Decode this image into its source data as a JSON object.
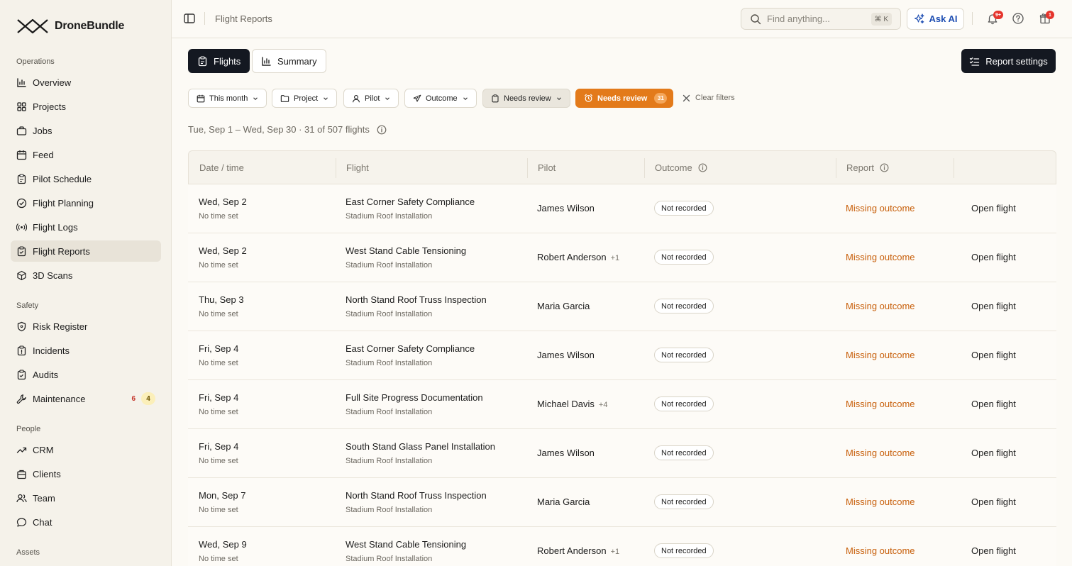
{
  "brand": {
    "name": "DroneBundle"
  },
  "sidebar": {
    "sections": [
      {
        "label": "Operations",
        "items": [
          {
            "label": "Overview",
            "icon": "chart-icon"
          },
          {
            "label": "Projects",
            "icon": "grid-icon"
          },
          {
            "label": "Jobs",
            "icon": "briefcase-icon"
          },
          {
            "label": "Feed",
            "icon": "calendar-icon"
          },
          {
            "label": "Pilot Schedule",
            "icon": "clipboard-icon"
          },
          {
            "label": "Flight Planning",
            "icon": "check-circle-icon"
          },
          {
            "label": "Flight Logs",
            "icon": "broadcast-icon"
          },
          {
            "label": "Flight Reports",
            "icon": "clipboard-check-icon",
            "active": true
          },
          {
            "label": "3D Scans",
            "icon": "cube-icon"
          }
        ]
      },
      {
        "label": "Safety",
        "items": [
          {
            "label": "Risk Register",
            "icon": "shield-icon"
          },
          {
            "label": "Incidents",
            "icon": "clipboard-alert-icon"
          },
          {
            "label": "Audits",
            "icon": "clipboard-check-icon"
          },
          {
            "label": "Maintenance",
            "icon": "wrench-icon",
            "badge_red": "6",
            "badge_yellow": "4"
          }
        ]
      },
      {
        "label": "People",
        "items": [
          {
            "label": "CRM",
            "icon": "trend-icon"
          },
          {
            "label": "Clients",
            "icon": "building-icon"
          },
          {
            "label": "Team",
            "icon": "users-icon"
          },
          {
            "label": "Chat",
            "icon": "chat-icon"
          }
        ]
      },
      {
        "label": "Assets",
        "items": []
      }
    ]
  },
  "topbar": {
    "title": "Flight Reports",
    "search_placeholder": "Find anything...",
    "search_shortcut": "⌘ K",
    "ask_ai": "Ask AI",
    "notifications_badge": "9+",
    "gift_badge": "1"
  },
  "views": {
    "flights": "Flights",
    "summary": "Summary"
  },
  "report_settings": "Report settings",
  "filters": {
    "date": "This month",
    "project": "Project",
    "pilot": "Pilot",
    "outcome": "Outcome",
    "needs_review_select": "Needs review",
    "needs_review_active": "Needs review",
    "needs_review_count": "31",
    "clear": "Clear filters"
  },
  "summary_line": "Tue, Sep 1 – Wed, Sep 30 · 31 of 507 flights",
  "table": {
    "headers": {
      "date": "Date / time",
      "flight": "Flight",
      "pilot": "Pilot",
      "outcome": "Outcome",
      "report": "Report"
    },
    "rows": [
      {
        "date": "Wed, Sep 2",
        "time": "No time set",
        "flight": "East Corner Safety Compliance",
        "project": "Stadium Roof Installation",
        "pilot": "James Wilson",
        "pilot_extra": "",
        "outcome": "Not recorded",
        "report": "Missing outcome",
        "action": "Open flight"
      },
      {
        "date": "Wed, Sep 2",
        "time": "No time set",
        "flight": "West Stand Cable Tensioning",
        "project": "Stadium Roof Installation",
        "pilot": "Robert Anderson",
        "pilot_extra": "+1",
        "outcome": "Not recorded",
        "report": "Missing outcome",
        "action": "Open flight"
      },
      {
        "date": "Thu, Sep 3",
        "time": "No time set",
        "flight": "North Stand Roof Truss Inspection",
        "project": "Stadium Roof Installation",
        "pilot": "Maria Garcia",
        "pilot_extra": "",
        "outcome": "Not recorded",
        "report": "Missing outcome",
        "action": "Open flight"
      },
      {
        "date": "Fri, Sep 4",
        "time": "No time set",
        "flight": "East Corner Safety Compliance",
        "project": "Stadium Roof Installation",
        "pilot": "James Wilson",
        "pilot_extra": "",
        "outcome": "Not recorded",
        "report": "Missing outcome",
        "action": "Open flight"
      },
      {
        "date": "Fri, Sep 4",
        "time": "No time set",
        "flight": "Full Site Progress Documentation",
        "project": "Stadium Roof Installation",
        "pilot": "Michael Davis",
        "pilot_extra": "+4",
        "outcome": "Not recorded",
        "report": "Missing outcome",
        "action": "Open flight"
      },
      {
        "date": "Fri, Sep 4",
        "time": "No time set",
        "flight": "South Stand Glass Panel Installation",
        "project": "Stadium Roof Installation",
        "pilot": "James Wilson",
        "pilot_extra": "",
        "outcome": "Not recorded",
        "report": "Missing outcome",
        "action": "Open flight"
      },
      {
        "date": "Mon, Sep 7",
        "time": "No time set",
        "flight": "North Stand Roof Truss Inspection",
        "project": "Stadium Roof Installation",
        "pilot": "Maria Garcia",
        "pilot_extra": "",
        "outcome": "Not recorded",
        "report": "Missing outcome",
        "action": "Open flight"
      },
      {
        "date": "Wed, Sep 9",
        "time": "No time set",
        "flight": "West Stand Cable Tensioning",
        "project": "Stadium Roof Installation",
        "pilot": "Robert Anderson",
        "pilot_extra": "+1",
        "outcome": "Not recorded",
        "report": "Missing outcome",
        "action": "Open flight"
      }
    ]
  },
  "colors": {
    "accent_orange": "#e37a1a",
    "missing_text": "#c8600c",
    "dark_button": "#141821",
    "ask_ai_blue": "#1f4fb3"
  }
}
